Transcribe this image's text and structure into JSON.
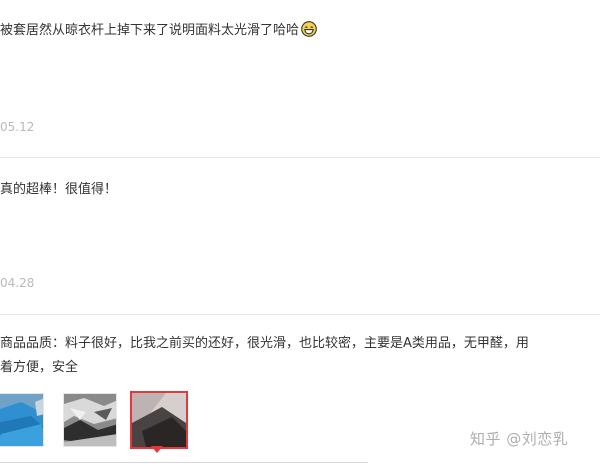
{
  "reviews": [
    {
      "text": "被套居然从晾衣杆上掉下来了说明面料太光滑了哈哈",
      "emoji": "grinning-emoji",
      "date": "05.12"
    },
    {
      "text": "真的超棒！很值得！",
      "date": "04.28"
    },
    {
      "text_line1": "商品品质：料子很好，比我之前买的还好，很光滑，也比较密，主要是A类用品，无甲醛，用",
      "text_line2": "着方便，安全"
    }
  ],
  "watermark": "知乎 @刘恋乳",
  "colors": {
    "selected_border": "#e4393c",
    "divider": "#e6e6e6",
    "date": "#b9b9b9"
  }
}
